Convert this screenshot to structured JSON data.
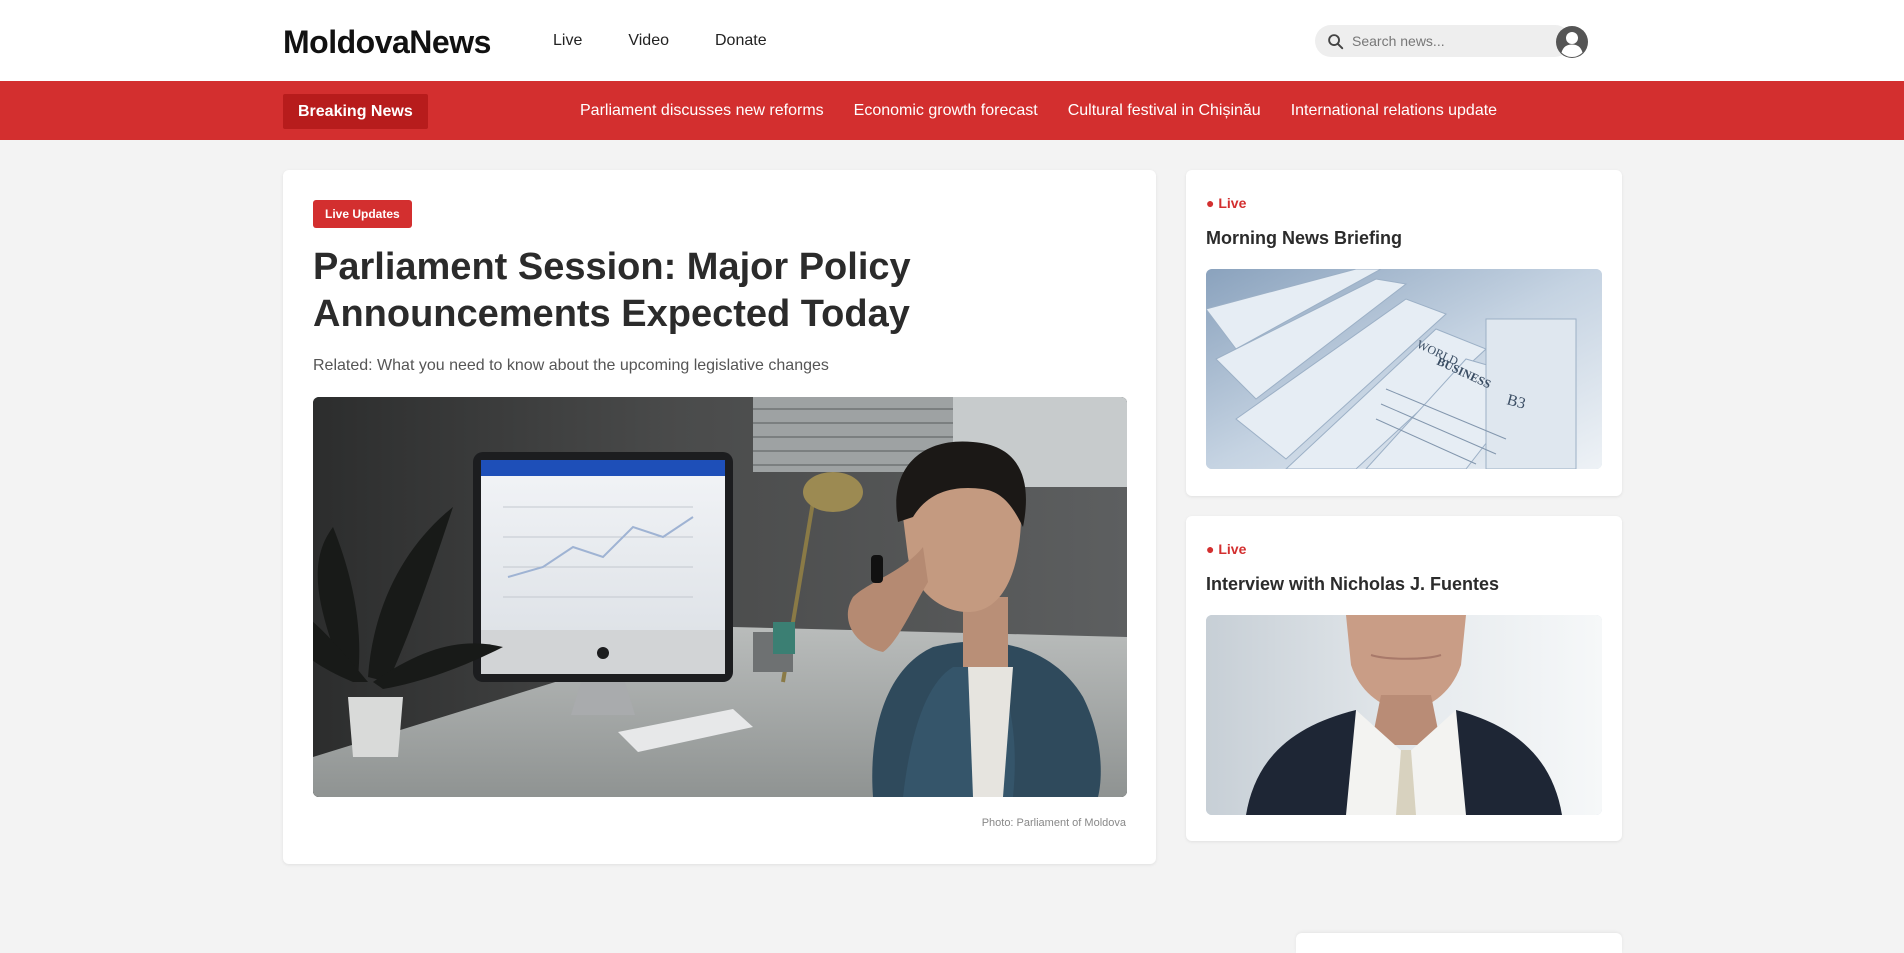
{
  "brand": {
    "logo_text": "MoldovaNews"
  },
  "nav": {
    "items": [
      "Live",
      "Video",
      "Donate"
    ]
  },
  "search": {
    "placeholder": "Search news..."
  },
  "breaking": {
    "label": "Breaking News",
    "items": [
      "Parliament discusses new reforms",
      "Economic growth forecast",
      "Cultural festival in Chișinău",
      "International relations update"
    ]
  },
  "main_article": {
    "badge": "Live Updates",
    "title": "Parliament Session: Major Policy Announcements Expected Today",
    "related": "Related: What you need to know about the upcoming legislative changes",
    "photo_credit": "Photo: Parliament of Moldova"
  },
  "side_cards": [
    {
      "live_label": "● Live",
      "title": "Morning News Briefing"
    },
    {
      "live_label": "● Live",
      "title": "Interview with Nicholas J. Fuentes"
    }
  ],
  "colors": {
    "accent": "#d32f2f",
    "accent_dark": "#b71c1c",
    "background": "#f3f3f3"
  },
  "icons": {
    "search": "search-icon",
    "avatar": "user-avatar-icon"
  }
}
